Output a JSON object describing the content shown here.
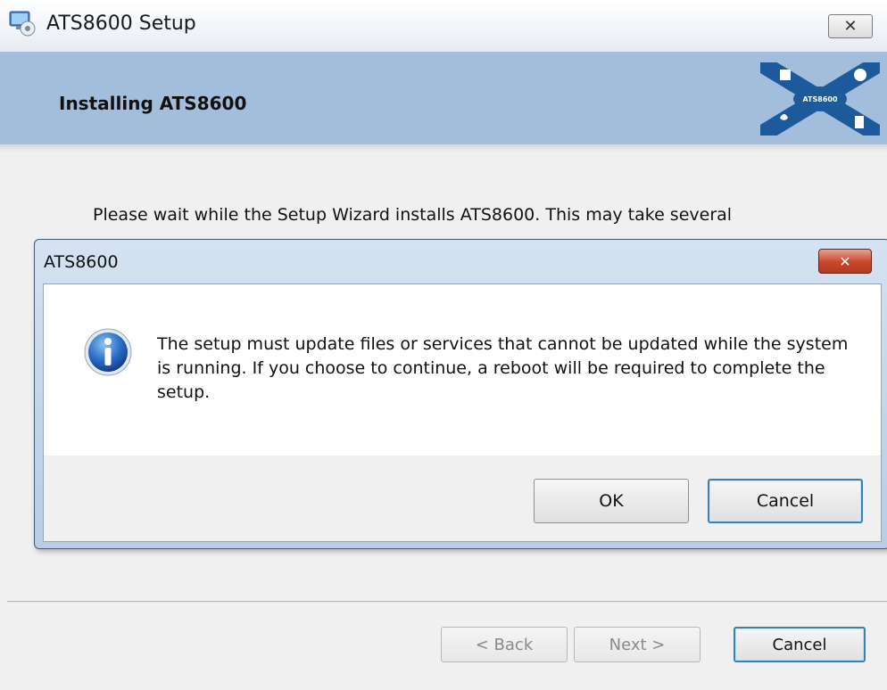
{
  "window": {
    "title": "ATS8600 Setup",
    "close_glyph": "✕",
    "icon": "setup-computer-icon"
  },
  "banner": {
    "title": "Installing ATS8600",
    "logo_text": "ATS8600"
  },
  "body": {
    "status_text": "Please wait while the Setup Wizard installs ATS8600.  This may take several"
  },
  "footer": {
    "back_label": "< Back",
    "next_label": "Next >",
    "cancel_label": "Cancel"
  },
  "dialog": {
    "title": "ATS8600",
    "close_glyph": "✕",
    "icon": "info-icon",
    "message": "The setup must update files or services that cannot be updated while the system is running. If you choose to continue, a reboot will be required to complete the setup.",
    "ok_label": "OK",
    "cancel_label": "Cancel"
  },
  "colors": {
    "banner": "#a3bddc",
    "dialog_close": "#c9452a",
    "default_button_border": "#3c7fb1"
  }
}
